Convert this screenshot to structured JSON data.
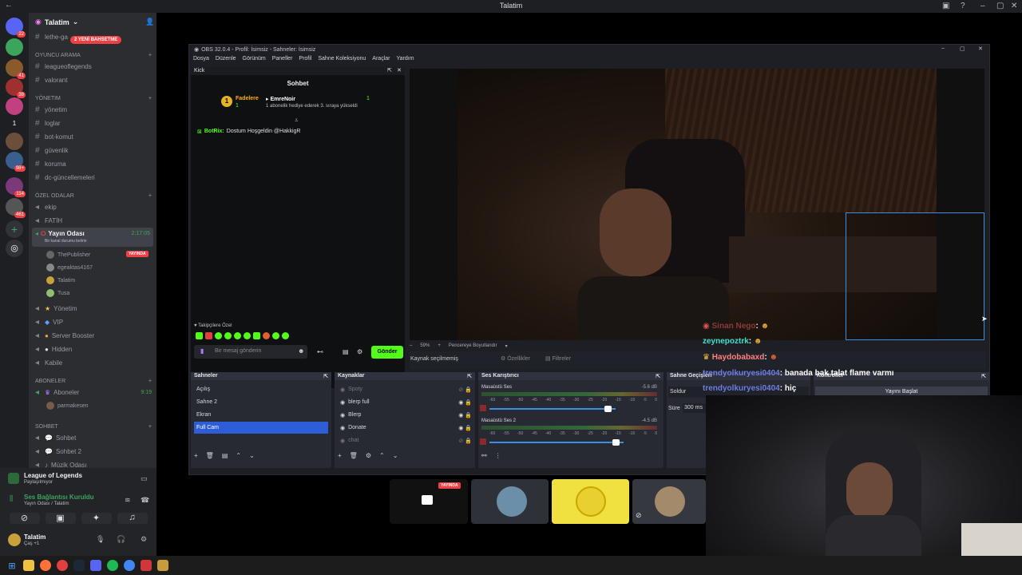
{
  "window_title": "Talatim",
  "server": {
    "name": "Talatim",
    "badge_new": "2 YENİ BAHSETME",
    "rail_badges": [
      "22",
      "41",
      "38",
      "1",
      "98+",
      "114",
      "461"
    ]
  },
  "channels": {
    "top_channel": "lethe-ga",
    "categories": {
      "oyuncu_arama": "OYUNCU ARAMA",
      "yonetim": "Yönetim",
      "ozel_odalar": "Özel Odalar",
      "aboneler": "ABONELER",
      "sohbet": "SOHBET"
    },
    "oyuncu": [
      "leagueoflegends",
      "valorant"
    ],
    "yonetim_list": [
      "yönetim",
      "loglar",
      "bot-komut",
      "güvenlik",
      "koruma",
      "dc-güncellemeleri"
    ],
    "ozel": [
      "ekip",
      "FATİH"
    ],
    "voice_active": {
      "name": "Yayın Odası",
      "time": "2:17:05",
      "sub": "Bir kanal durumu belirle",
      "users": [
        "ThePublisher",
        "egeaktas4167",
        "Talatim",
        "Tusa"
      ],
      "live_tag": "YAYINDA"
    },
    "voice_more": [
      "Yönetim",
      "VIP",
      "Server Booster",
      "Hidden",
      "Kabile"
    ],
    "aboneler_voice": {
      "name": "Aboneler",
      "time": "9:19",
      "user": "parmakesen"
    },
    "sohbet_list": [
      "Sohbet",
      "Sohbet 2",
      "Müzik Odası"
    ]
  },
  "user_panel": {
    "activity_title": "League of Legends",
    "activity_sub": "Paylaşılmıyor",
    "voice_status": "Ses Bağlantısı Kuruldu",
    "voice_channel": "Yayın Odası / Talatim",
    "username": "Talatim",
    "user_status": "Çaş +1"
  },
  "obs": {
    "title": "OBS 32.0.4 - Profil: İsimsiz - Sahneler: İsimsiz",
    "menu": [
      "Dosya",
      "Düzenle",
      "Görünüm",
      "Paneller",
      "Profil",
      "Sahne Koleksiyonu",
      "Araçlar",
      "Yardım"
    ],
    "kick": {
      "title": "Kick",
      "tab": "Sohbet",
      "pinned_name1": "Fadelere",
      "pinned_name2": "EmreNoir",
      "pinned_count1": "1",
      "pinned_count2": "1",
      "pinned_text": "1 abonelik hediye ederek 3. sıraya yükseldi",
      "bot_name": "BotRix:",
      "bot_msg": "Dostum Hoşgeldin @HakkigR",
      "emote_label": "Takipçilere Özel",
      "input_placeholder": "Bir mesaj gönderin",
      "send_label": "Gönder"
    },
    "preview": {
      "zoom": "59%",
      "scale_label": "Pencereye Boyutlandır",
      "source_none": "Kaynak seçilmemiş",
      "props_btn": "Özellikler",
      "filters_btn": "Filtreler"
    },
    "scenes": {
      "title": "Sahneler",
      "items": [
        "Açılış",
        "Sahne 2",
        "Ekran",
        "Full Cam"
      ],
      "selected": "Full Cam"
    },
    "sources": {
      "title": "Kaynaklar",
      "items": [
        "Spoty",
        "blerp full",
        "Blerp",
        "Donate",
        "chat"
      ]
    },
    "mixer": {
      "title": "Ses Karıştırıcı",
      "ch1": "Masaüstü Ses",
      "ch1_db": "-5.6 dB",
      "ch2": "Masaüstü Ses 2",
      "ch2_db": "-4.5 dB",
      "ticks": [
        "-60",
        "-55",
        "-50",
        "-45",
        "-40",
        "-35",
        "-30",
        "-25",
        "-20",
        "-15",
        "-10",
        "-5",
        "0"
      ]
    },
    "transitions": {
      "title": "Sahne Geçişleri",
      "type": "Soldur",
      "duration_label": "Süre",
      "duration_value": "300 ms"
    },
    "controls": {
      "title": "Kontroller",
      "start_stream": "Yayını Başlat"
    }
  },
  "overlay_chat": [
    {
      "user": "Sinan Nego",
      "sep": ":",
      "msg": "",
      "color": "#c06060"
    },
    {
      "user": "zeynepoztrk",
      "sep": ":",
      "msg": "",
      "color": "#40e0d0"
    },
    {
      "user": "Haydobabaxd",
      "sep": ":",
      "msg": "",
      "color": "#ff8080"
    },
    {
      "user": "trendyolkuryesi0404",
      "sep": ":",
      "msg": "banada bak talat flame varmı",
      "color": "#6f7fe6"
    },
    {
      "user": "trendyolkuryesi0404",
      "sep": ":",
      "msg": "hiç",
      "color": "#6f7fe6"
    }
  ],
  "stream_tag": "YAYINDA"
}
